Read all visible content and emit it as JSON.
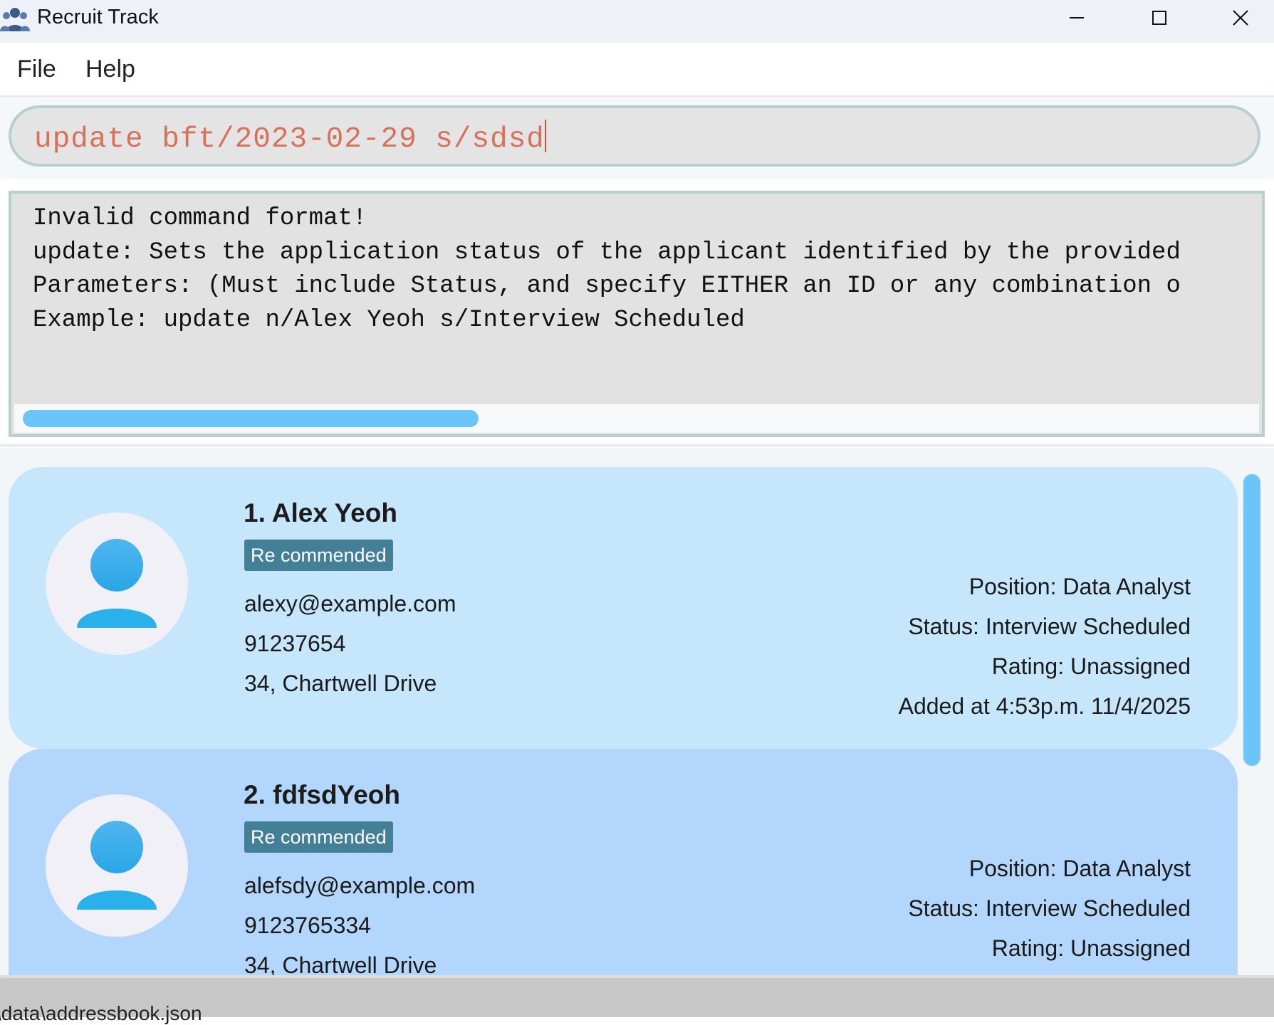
{
  "window": {
    "title": "Recruit Track"
  },
  "menu": {
    "file": "File",
    "help": "Help"
  },
  "command_box": {
    "value": "update bft/2023-02-29 s/sdsd"
  },
  "result_display": {
    "lines": [
      "Invalid command format!",
      "update: Sets the application status of the applicant identified by the provided",
      "Parameters: (Must include Status, and specify EITHER an ID or any combination o",
      "Example: update n/Alex Yeoh s/Interview Scheduled"
    ]
  },
  "applicants": [
    {
      "name": "1. Alex Yeoh",
      "tag": "Re commended",
      "email": "alexy@example.com",
      "phone": "91237654",
      "address": "34, Chartwell Drive",
      "position": "Position:  Data Analyst",
      "status": "Status:  Interview Scheduled",
      "rating": "Rating:  Unassigned",
      "added": "Added at 4:53p.m. 11/4/2025"
    },
    {
      "name": "2. fdfsdYeoh",
      "tag": "Re commended",
      "email": "alefsdy@example.com",
      "phone": "9123765334",
      "address": "34, Chartwell Drive",
      "position": "Position:  Data Analyst",
      "status": "Status:  Interview Scheduled",
      "rating": "Rating:  Unassigned"
    }
  ],
  "status_bar": {
    "text": "\\data\\addressbook.json"
  },
  "colors": {
    "card_1": "#c6e6fb",
    "card_2": "#b3d6fc",
    "tag": "#447f98",
    "command_text": "#d7715a",
    "scroll_thumb": "#6cc5f8"
  },
  "icons": [
    "app-people-icon",
    "minimize-icon",
    "maximize-icon",
    "close-icon",
    "user-avatar-icon"
  ]
}
